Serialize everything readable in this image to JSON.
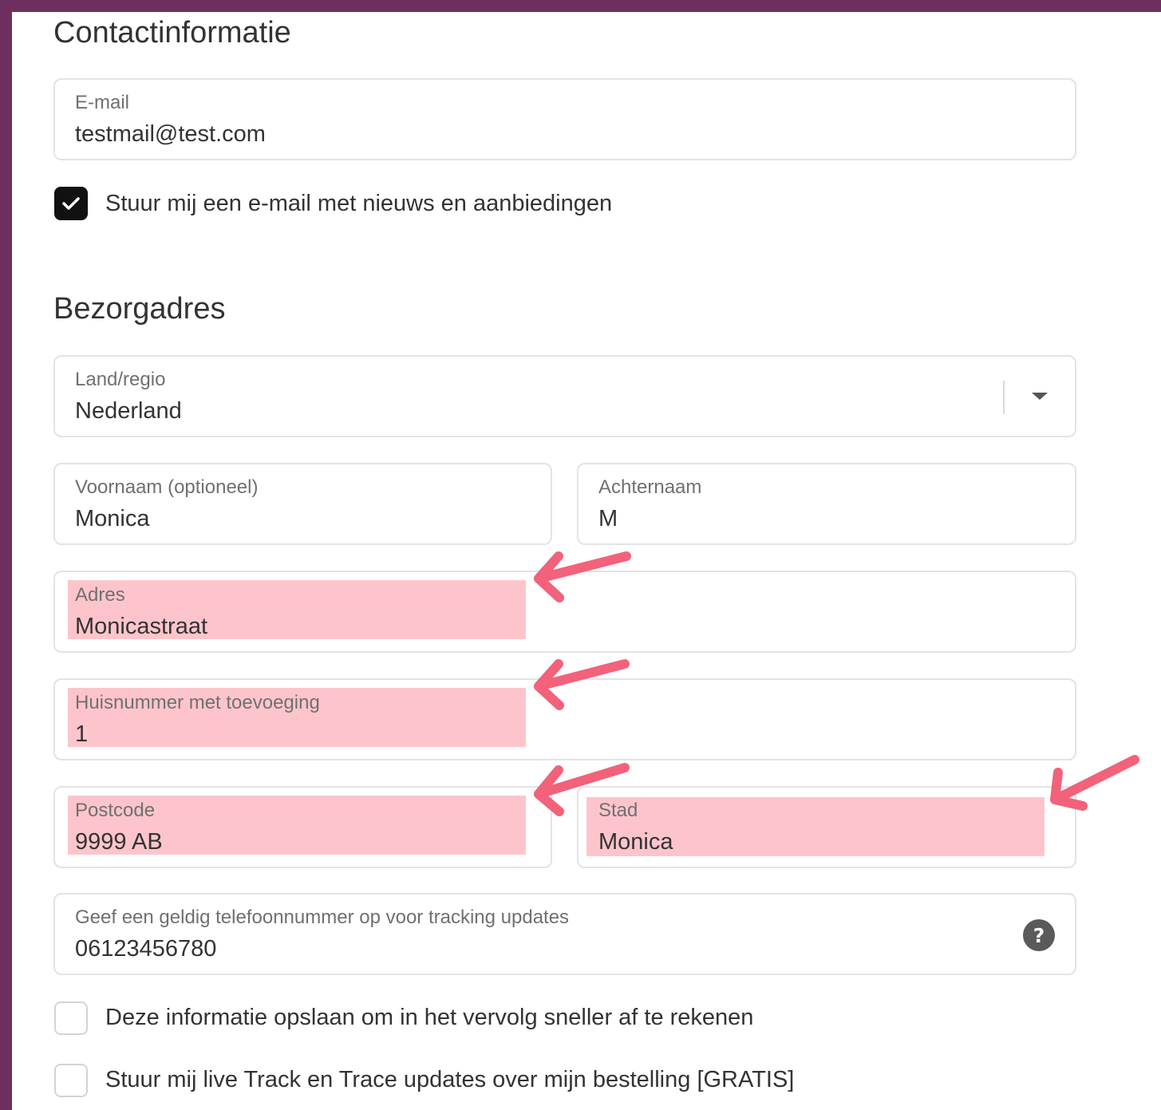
{
  "contact": {
    "title": "Contactinformatie",
    "email": {
      "label": "E-mail",
      "value": "testmail@test.com"
    },
    "newsletter": {
      "label": "Stuur mij een e-mail met nieuws en aanbiedingen",
      "checked": true
    }
  },
  "shipping": {
    "title": "Bezorgadres",
    "country": {
      "label": "Land/regio",
      "value": "Nederland"
    },
    "first_name": {
      "label": "Voornaam (optioneel)",
      "value": "Monica"
    },
    "last_name": {
      "label": "Achternaam",
      "value": "M"
    },
    "address": {
      "label": "Adres",
      "value": "Monicastraat"
    },
    "house_number": {
      "label": "Huisnummer met toevoeging",
      "value": "1"
    },
    "postcode": {
      "label": "Postcode",
      "value": "9999 AB"
    },
    "city": {
      "label": "Stad",
      "value": "Monica"
    },
    "phone": {
      "label": "Geef een geldig telefoonnummer op voor tracking updates",
      "value": "06123456780"
    }
  },
  "options": {
    "save_info": {
      "label": "Deze informatie opslaan om in het vervolg sneller af te rekenen",
      "checked": false
    },
    "track_trace": {
      "label": "Stuur mij live Track en Trace updates over mijn bestelling [GRATIS]",
      "checked": false
    }
  },
  "colors": {
    "frame": "#6e2f5f",
    "highlight": "#fdc5cb",
    "arrow": "#f2627a"
  },
  "icons": {
    "dropdown": "chevron-down-icon",
    "help": "question-circle-icon",
    "check": "checkmark-icon",
    "annotation": "arrow-icon"
  }
}
